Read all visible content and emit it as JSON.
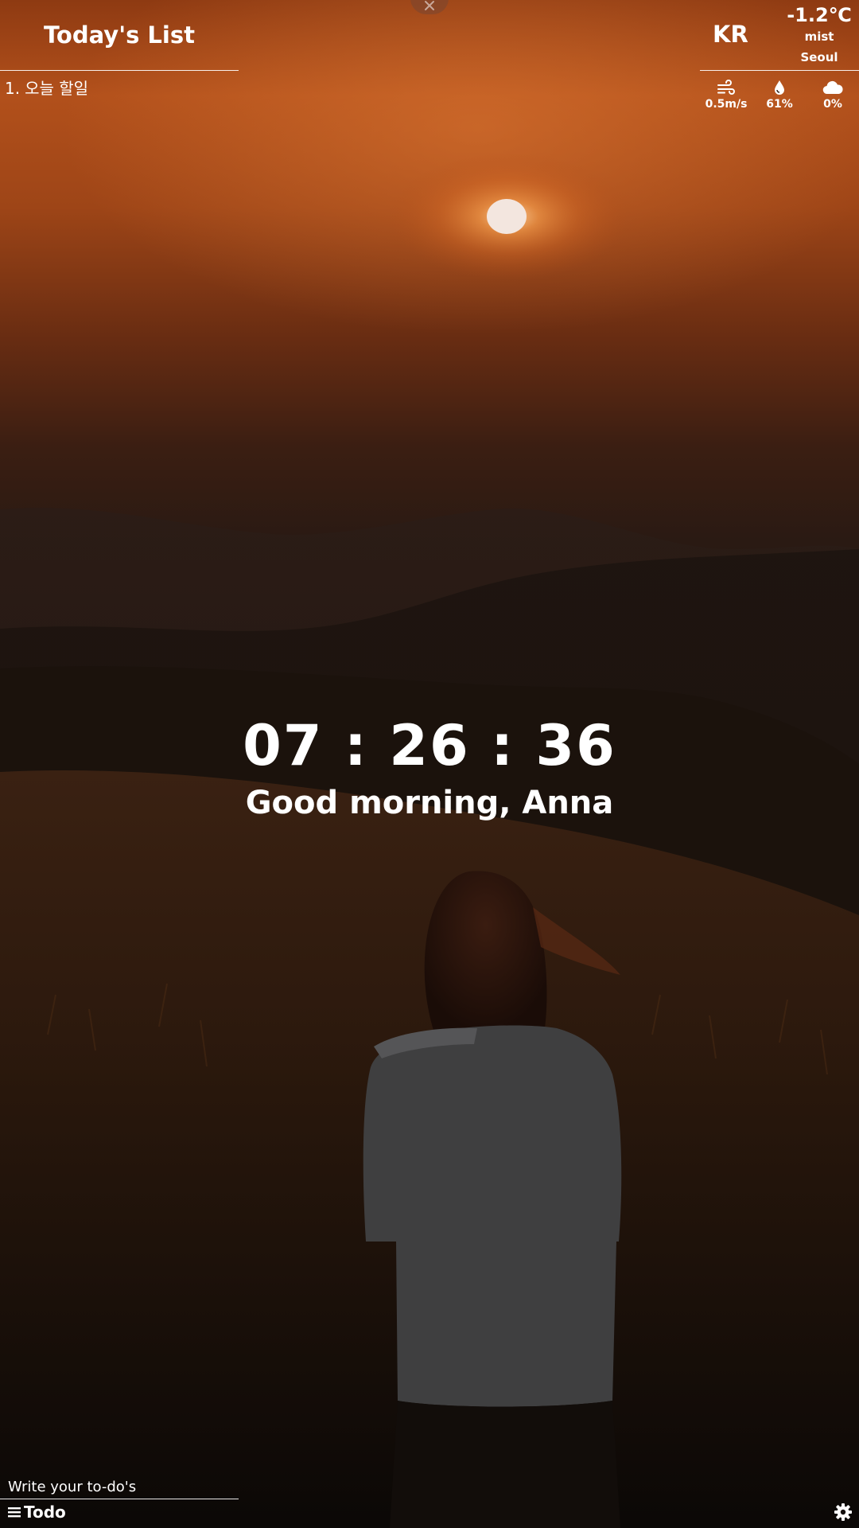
{
  "todo": {
    "title": "Today's List",
    "items": [
      {
        "index": "1.",
        "text": "오늘 할일"
      }
    ],
    "input_placeholder": "Write your to-do's",
    "toggle_label": "Todo",
    "toggle_icon": "hamburger-menu-icon"
  },
  "weather": {
    "country": "KR",
    "temperature": "-1.2℃",
    "description": "mist",
    "city": "Seoul",
    "wind": {
      "icon": "wind-icon",
      "value": "0.5m/s"
    },
    "humidity": {
      "icon": "water-drop-icon",
      "value": "61%"
    },
    "clouds": {
      "icon": "cloud-icon",
      "value": "0%"
    }
  },
  "clock": {
    "time": "07 : 26 : 36",
    "greeting": "Good morning, Anna"
  },
  "controls": {
    "close_icon": "close-icon",
    "settings_icon": "gear-icon"
  },
  "colors": {
    "text": "#ffffff",
    "sky_accent": "#c15a1f"
  }
}
